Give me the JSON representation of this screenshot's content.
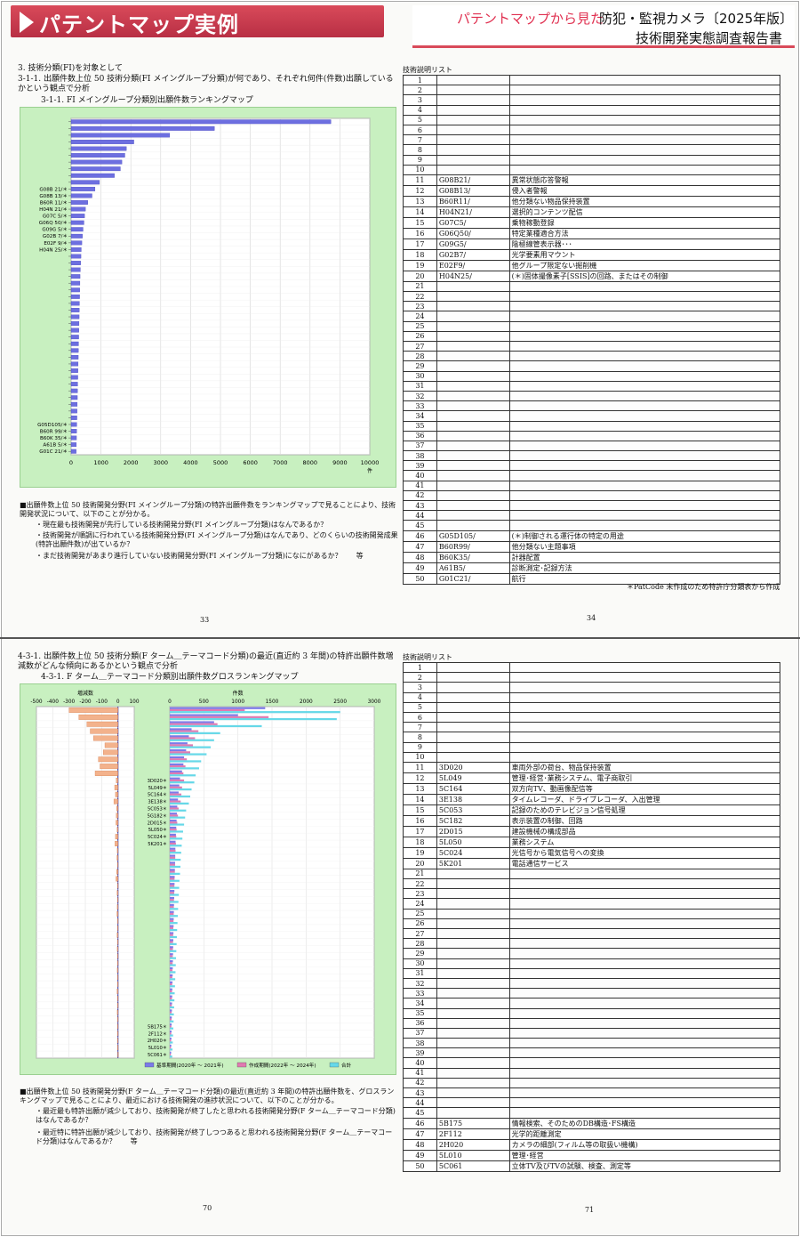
{
  "header": {
    "title": "パテントマップ実例",
    "subtitle": "パテントマップから見た",
    "product": "防犯・監視カメラ〔2025年版〕",
    "report": "技術開発実態調査報告書"
  },
  "page33": {
    "h1": "3. 技術分類(FI)を対象として",
    "h2": "3-1-1. 出願件数上位 50 技術分類(FI メイングループ分類)が何であり、それぞれ何件(件数)出願しているかという観点で分析",
    "fig_title": "3-1-1. FI メイングループ分類別出願件数ランキングマップ",
    "notes": [
      "■出願件数上位 50 技術開発分野(FI メイングループ分類)の特許出願件数をランキングマップで見ることにより、技術開発状況について、以下のことが分かる。",
      "・現在最も技術開発が先行している技術開発分野(FI メイングループ分類)はなんであるか？",
      "・技術開発が順調に行われている技術開発分野(FI メイングループ分類)はなんであり、どのくらいの技術開発成果(特許出願件数)が出ているか？",
      "・まだ技術開発があまり進行していない技術開発分野(FI メイングループ分類)になにがあるか？　　等"
    ],
    "page_no": "33"
  },
  "page34": {
    "list_title": "技術説明リスト",
    "rows": [
      {
        "n": "1",
        "c": "",
        "d": ""
      },
      {
        "n": "2",
        "c": "",
        "d": ""
      },
      {
        "n": "3",
        "c": "",
        "d": ""
      },
      {
        "n": "4",
        "c": "",
        "d": ""
      },
      {
        "n": "5",
        "c": "",
        "d": ""
      },
      {
        "n": "6",
        "c": "",
        "d": ""
      },
      {
        "n": "7",
        "c": "",
        "d": ""
      },
      {
        "n": "8",
        "c": "",
        "d": ""
      },
      {
        "n": "9",
        "c": "",
        "d": ""
      },
      {
        "n": "10",
        "c": "",
        "d": ""
      },
      {
        "n": "11",
        "c": "G08B21/",
        "d": "異常状態応答警報"
      },
      {
        "n": "12",
        "c": "G08B13/",
        "d": "侵入者警報"
      },
      {
        "n": "13",
        "c": "B60R11/",
        "d": "他分類ない物品保持装置"
      },
      {
        "n": "14",
        "c": "H04N21/",
        "d": "選択的コンテンツ配信"
      },
      {
        "n": "15",
        "c": "G07C5/",
        "d": "乗物稼動登録"
      },
      {
        "n": "16",
        "c": "G06Q50/",
        "d": "特定業種適合方法"
      },
      {
        "n": "17",
        "c": "G09G5/",
        "d": "陰極線管表示器･･･"
      },
      {
        "n": "18",
        "c": "G02B7/",
        "d": "光学要素用マウント"
      },
      {
        "n": "19",
        "c": "E02F9/",
        "d": "他グループ限定ない掘削機"
      },
      {
        "n": "20",
        "c": "H04N25/",
        "d": "(＊)固体撮像素子[SSIS]の回路、またはその制御"
      },
      {
        "n": "21",
        "c": "",
        "d": ""
      },
      {
        "n": "22",
        "c": "",
        "d": ""
      },
      {
        "n": "23",
        "c": "",
        "d": ""
      },
      {
        "n": "24",
        "c": "",
        "d": ""
      },
      {
        "n": "25",
        "c": "",
        "d": ""
      },
      {
        "n": "26",
        "c": "",
        "d": ""
      },
      {
        "n": "27",
        "c": "",
        "d": ""
      },
      {
        "n": "28",
        "c": "",
        "d": ""
      },
      {
        "n": "29",
        "c": "",
        "d": ""
      },
      {
        "n": "30",
        "c": "",
        "d": ""
      },
      {
        "n": "31",
        "c": "",
        "d": ""
      },
      {
        "n": "32",
        "c": "",
        "d": ""
      },
      {
        "n": "33",
        "c": "",
        "d": ""
      },
      {
        "n": "34",
        "c": "",
        "d": ""
      },
      {
        "n": "35",
        "c": "",
        "d": ""
      },
      {
        "n": "36",
        "c": "",
        "d": ""
      },
      {
        "n": "37",
        "c": "",
        "d": ""
      },
      {
        "n": "38",
        "c": "",
        "d": ""
      },
      {
        "n": "39",
        "c": "",
        "d": ""
      },
      {
        "n": "40",
        "c": "",
        "d": ""
      },
      {
        "n": "41",
        "c": "",
        "d": ""
      },
      {
        "n": "42",
        "c": "",
        "d": ""
      },
      {
        "n": "43",
        "c": "",
        "d": ""
      },
      {
        "n": "44",
        "c": "",
        "d": ""
      },
      {
        "n": "45",
        "c": "",
        "d": ""
      },
      {
        "n": "46",
        "c": "G05D105/",
        "d": "(＊)制御される運行体の特定の用途"
      },
      {
        "n": "47",
        "c": "B60R99/",
        "d": "他分類ない主題事項"
      },
      {
        "n": "48",
        "c": "B60K35/",
        "d": "計器配置"
      },
      {
        "n": "49",
        "c": "A61B5/",
        "d": "診断測定･記録方法"
      },
      {
        "n": "50",
        "c": "G01C21/",
        "d": "航行"
      }
    ],
    "footnote": "＊PatCode 未作成のため特許庁分類表から作成",
    "page_no": "34"
  },
  "page70": {
    "h2": "4-3-1. 出願件数上位 50 技術分類(F ターム＿テーマコード分類)の最近(直近約 3 年間)の特許出願件数増減数がどんな傾向にあるかという観点で分析",
    "fig_title": "4-3-1. F ターム＿テーマコード分類別出願件数グロスランキングマップ",
    "axis_left_label": "増減数",
    "axis_right_label": "件数",
    "legend": [
      "基準期間(2020年 〜 2021年)",
      "作成期間(2022年 〜 2024年)",
      "合計"
    ],
    "notes": [
      "■出願件数上位 50 技術開発分野(F ターム＿テーマコード分類)の最近(直近約 3 年間)の特許出願件数を、グロスランキングマップで見ることにより、最近における技術開発の進捗状況について、以下のことが分かる。",
      "・最近最も特許出願が減少しており、技術開発が終了したと思われる技術開発分野(F ターム＿テーマコード分類)はなんであるか？",
      "・最近特に特許出願が減少しており、技術開発が終了しつつあると思われる技術開発分野(F ターム＿テーマコード分類)はなんであるか？　　等"
    ],
    "page_no": "70"
  },
  "page71": {
    "list_title": "技術説明リスト",
    "rows": [
      {
        "n": "1",
        "c": "",
        "d": ""
      },
      {
        "n": "2",
        "c": "",
        "d": ""
      },
      {
        "n": "3",
        "c": "",
        "d": ""
      },
      {
        "n": "4",
        "c": "",
        "d": ""
      },
      {
        "n": "5",
        "c": "",
        "d": ""
      },
      {
        "n": "6",
        "c": "",
        "d": ""
      },
      {
        "n": "7",
        "c": "",
        "d": ""
      },
      {
        "n": "8",
        "c": "",
        "d": ""
      },
      {
        "n": "9",
        "c": "",
        "d": ""
      },
      {
        "n": "10",
        "c": "",
        "d": ""
      },
      {
        "n": "11",
        "c": "3D020",
        "d": "車両外部の荷台、物品保持装置"
      },
      {
        "n": "12",
        "c": "5L049",
        "d": "管理･経営･業務システム、電子商取引"
      },
      {
        "n": "13",
        "c": "5C164",
        "d": "双方向TV、動画像配信等"
      },
      {
        "n": "14",
        "c": "3E138",
        "d": "タイムレコーダ、ドライブレコーダ、入出管理"
      },
      {
        "n": "15",
        "c": "5C053",
        "d": "記録のためのテレビジョン信号処理"
      },
      {
        "n": "16",
        "c": "5C182",
        "d": "表示装置の制御、回路"
      },
      {
        "n": "17",
        "c": "2D015",
        "d": "建設機械の構成部品"
      },
      {
        "n": "18",
        "c": "5L050",
        "d": "業務システム"
      },
      {
        "n": "19",
        "c": "5C024",
        "d": "光信号から電気信号への変換"
      },
      {
        "n": "20",
        "c": "5K201",
        "d": "電話通信サービス"
      },
      {
        "n": "21",
        "c": "",
        "d": ""
      },
      {
        "n": "22",
        "c": "",
        "d": ""
      },
      {
        "n": "23",
        "c": "",
        "d": ""
      },
      {
        "n": "24",
        "c": "",
        "d": ""
      },
      {
        "n": "25",
        "c": "",
        "d": ""
      },
      {
        "n": "26",
        "c": "",
        "d": ""
      },
      {
        "n": "27",
        "c": "",
        "d": ""
      },
      {
        "n": "28",
        "c": "",
        "d": ""
      },
      {
        "n": "29",
        "c": "",
        "d": ""
      },
      {
        "n": "30",
        "c": "",
        "d": ""
      },
      {
        "n": "31",
        "c": "",
        "d": ""
      },
      {
        "n": "32",
        "c": "",
        "d": ""
      },
      {
        "n": "33",
        "c": "",
        "d": ""
      },
      {
        "n": "34",
        "c": "",
        "d": ""
      },
      {
        "n": "35",
        "c": "",
        "d": ""
      },
      {
        "n": "36",
        "c": "",
        "d": ""
      },
      {
        "n": "37",
        "c": "",
        "d": ""
      },
      {
        "n": "38",
        "c": "",
        "d": ""
      },
      {
        "n": "39",
        "c": "",
        "d": ""
      },
      {
        "n": "40",
        "c": "",
        "d": ""
      },
      {
        "n": "41",
        "c": "",
        "d": ""
      },
      {
        "n": "42",
        "c": "",
        "d": ""
      },
      {
        "n": "43",
        "c": "",
        "d": ""
      },
      {
        "n": "44",
        "c": "",
        "d": ""
      },
      {
        "n": "45",
        "c": "",
        "d": ""
      },
      {
        "n": "46",
        "c": "5B175",
        "d": "情報検索、そのためのDB構造･FS構造"
      },
      {
        "n": "47",
        "c": "2F112",
        "d": "光学的距離測定"
      },
      {
        "n": "48",
        "c": "2H020",
        "d": "カメラの細部(フィルム等の取扱い機構)"
      },
      {
        "n": "49",
        "c": "5L010",
        "d": "管理･経営"
      },
      {
        "n": "50",
        "c": "5C061",
        "d": "立体TV及びTVの試験、検査、測定等"
      }
    ],
    "page_no": "71"
  },
  "chart_data": [
    {
      "type": "bar",
      "orientation": "horizontal",
      "title": "3-1-1. FI メイングループ分類別出願件数ランキングマップ",
      "xlabel": "件",
      "xlim": [
        0,
        10000
      ],
      "xticks": [
        0,
        1000,
        2000,
        3000,
        4000,
        5000,
        6000,
        7000,
        8000,
        9000,
        10000
      ],
      "categories": [
        "",
        "",
        "",
        "",
        "",
        "",
        "",
        "",
        "",
        "",
        "G08B 21/＊",
        "G08B 13/＊",
        "B60R 11/＊",
        "H04N 21/＊",
        "G07C 5/＊",
        "G06Q 50/＊",
        "G09G 5/＊",
        "G02B 7/＊",
        "E02F 9/＊",
        "H04N 25/＊",
        "",
        "",
        "",
        "",
        "",
        "",
        "",
        "",
        "",
        "",
        "",
        "",
        "",
        "",
        "",
        "",
        "",
        "",
        "",
        "",
        "",
        "",
        "",
        "",
        "",
        "G05D105/＊",
        "B60R 99/＊",
        "B60K 35/＊",
        "A61B 5/＊",
        "G01C 21/＊"
      ],
      "values": [
        8700,
        4800,
        3300,
        2100,
        1850,
        1800,
        1700,
        1650,
        1450,
        950,
        800,
        700,
        560,
        480,
        450,
        430,
        400,
        380,
        360,
        340,
        330,
        320,
        310,
        300,
        295,
        290,
        285,
        280,
        275,
        270,
        265,
        260,
        255,
        250,
        245,
        240,
        235,
        230,
        225,
        220,
        215,
        210,
        205,
        200,
        195,
        190,
        185,
        180,
        175,
        170
      ]
    },
    {
      "type": "bar",
      "orientation": "horizontal",
      "title": "4-3-1. F ターム＿テーマコード分類別出願件数グロスランキングマップ",
      "left_panel": {
        "xlabel": "増減数",
        "xlim": [
          -500,
          100
        ],
        "xticks": [
          -500,
          -400,
          -300,
          -200,
          -100,
          0,
          100
        ]
      },
      "right_panel": {
        "xlabel": "件数",
        "xlim": [
          0,
          3000
        ],
        "xticks": [
          0,
          500,
          1000,
          1500,
          2000,
          2500,
          3000
        ]
      },
      "categories": [
        "",
        "",
        "",
        "",
        "",
        "",
        "",
        "",
        "",
        "",
        "3D020＊",
        "5L049＊",
        "5C164＊",
        "3E138＊",
        "5C053＊",
        "5G182＊",
        "2D015＊",
        "5L050＊",
        "5C024＊",
        "5K201＊",
        "",
        "",
        "",
        "",
        "",
        "",
        "",
        "",
        "",
        "",
        "",
        "",
        "",
        "",
        "",
        "",
        "",
        "",
        "",
        "",
        "",
        "",
        "",
        "",
        "",
        "5B175＊",
        "2F112＊",
        "2H020＊",
        "5L010＊",
        "5C061＊"
      ],
      "series": [
        {
          "name": "基準期間(2020年 〜 2021年)",
          "values": [
            1400,
            1000,
            650,
            320,
            280,
            260,
            240,
            210,
            200,
            180,
            150,
            140,
            130,
            120,
            110,
            105,
            100,
            95,
            90,
            85,
            82,
            80,
            78,
            75,
            72,
            70,
            68,
            65,
            62,
            60,
            58,
            56,
            54,
            52,
            50,
            48,
            46,
            44,
            42,
            40,
            38,
            36,
            34,
            32,
            30,
            28,
            26,
            24,
            22,
            20
          ]
        },
        {
          "name": "作成期間(2022年 〜 2024年)",
          "values": [
            1100,
            1450,
            700,
            420,
            370,
            340,
            300,
            250,
            230,
            200,
            210,
            180,
            170,
            160,
            130,
            120,
            110,
            100,
            95,
            90,
            85,
            80,
            78,
            75,
            70,
            68,
            65,
            62,
            60,
            58,
            55,
            52,
            50,
            48,
            46,
            44,
            42,
            40,
            38,
            36,
            34,
            32,
            30,
            28,
            26,
            24,
            22,
            20,
            18,
            16
          ]
        },
        {
          "name": "合計",
          "values": [
            2500,
            2450,
            1350,
            740,
            650,
            600,
            540,
            460,
            430,
            380,
            360,
            320,
            300,
            280,
            240,
            225,
            210,
            195,
            185,
            175,
            167,
            160,
            156,
            150,
            142,
            138,
            133,
            127,
            122,
            118,
            113,
            108,
            104,
            100,
            96,
            92,
            88,
            84,
            80,
            76,
            72,
            68,
            64,
            60,
            56,
            52,
            48,
            44,
            40,
            36
          ]
        }
      ],
      "delta": [
        -300,
        -240,
        -190,
        -170,
        -150,
        -80,
        -90,
        -120,
        -110,
        -140,
        -10,
        -20,
        -15,
        -25,
        -8,
        -10,
        -12,
        -5,
        -15,
        -18,
        -4,
        -6,
        -3,
        -8,
        -12,
        -2,
        -5,
        -3,
        -4,
        -6,
        -2,
        -3,
        -5,
        -2,
        -4,
        -3,
        -2,
        -4,
        -3,
        -2,
        -5,
        -3,
        -2,
        -4,
        -2,
        -3,
        -2,
        -3,
        -2,
        -1
      ]
    }
  ]
}
